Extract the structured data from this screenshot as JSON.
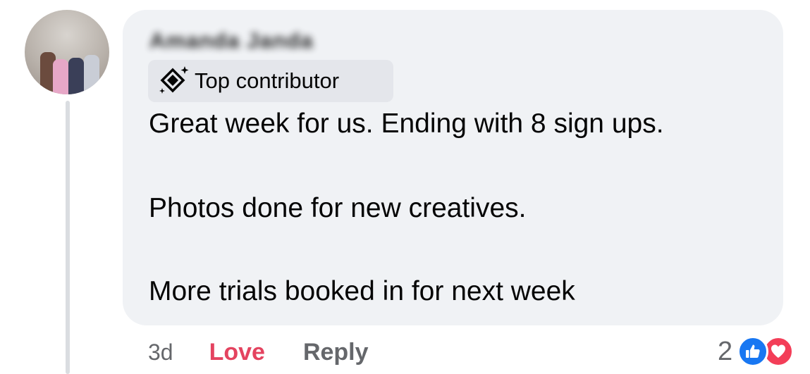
{
  "comment": {
    "author_name": "Amanda Janda",
    "badge_label": "Top contributor",
    "text_lines": [
      "Great week for us. Ending with 8 sign ups.",
      "Photos done for new creatives.",
      "More trials booked in for next week"
    ],
    "time": "3d",
    "love_label": "Love",
    "reply_label": "Reply",
    "reaction_count": "2",
    "reaction_icons": [
      "like-icon",
      "heart-icon"
    ]
  },
  "colors": {
    "bubble": "#f0f2f5",
    "love_text": "#e4435f",
    "secondary_text": "#65676b",
    "like_blue": "#1877f2",
    "heart_red": "#f33e58"
  }
}
